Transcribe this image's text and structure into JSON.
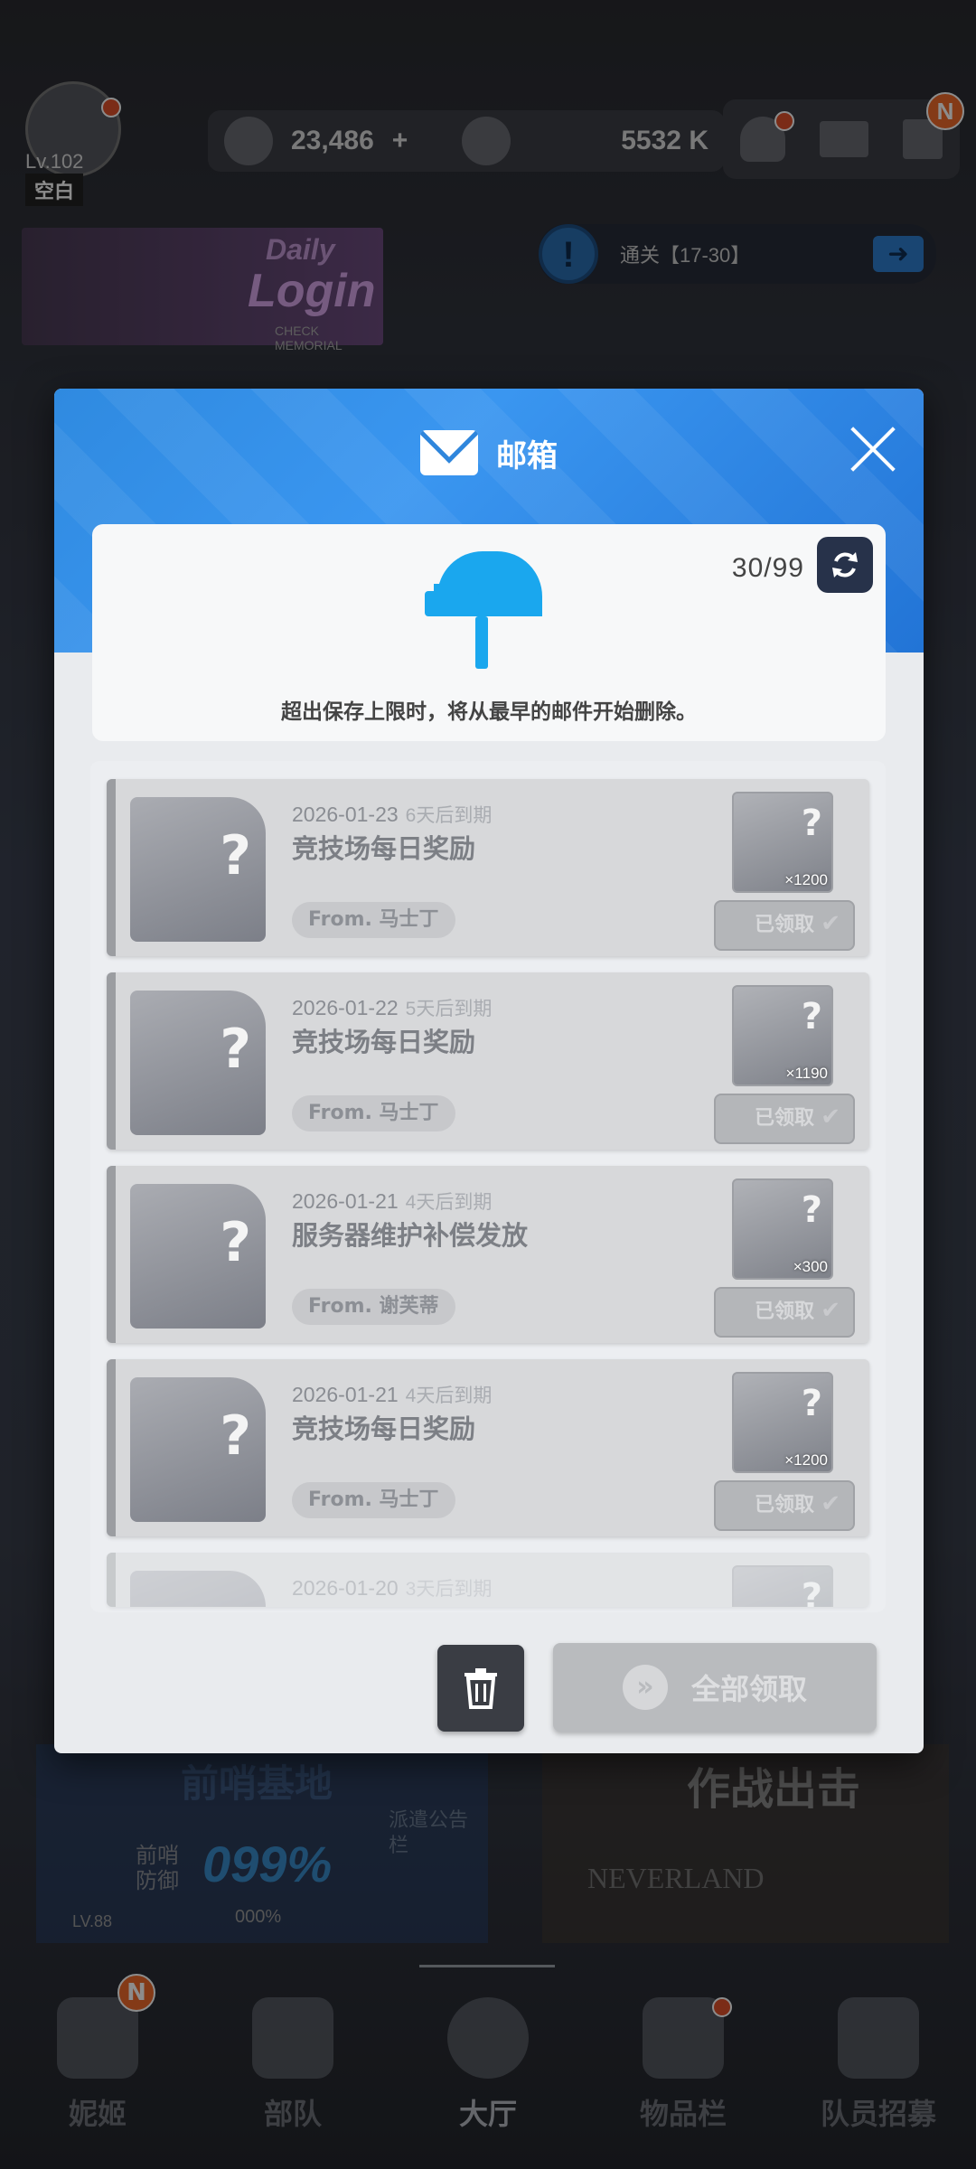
{
  "hud": {
    "player_level": "Lv.102",
    "player_name": "空白",
    "currency_1": "23,486",
    "currency_1_plus": "+",
    "currency_2": "5532 K",
    "mission_text": "通关【17-30】",
    "banner_text_1": "Daily",
    "banner_text_2": "Login",
    "banner_sub": "CHECK MEMORIAL",
    "notification_badge": "N"
  },
  "modal": {
    "title": "邮箱",
    "count": "30/99",
    "info_text": "超出保存上限时，将从最早的邮件开始删除。",
    "claim_all_label": "全部领取",
    "mails": [
      {
        "date": "2026-01-23",
        "expire": "6天后到期",
        "subject": "竞技场每日奖励",
        "from": "From. 马士丁",
        "qty": "×1200",
        "status": "已领取"
      },
      {
        "date": "2026-01-22",
        "expire": "5天后到期",
        "subject": "竞技场每日奖励",
        "from": "From. 马士丁",
        "qty": "×1190",
        "status": "已领取"
      },
      {
        "date": "2026-01-21",
        "expire": "4天后到期",
        "subject": "服务器维护补偿发放",
        "from": "From. 谢芙蒂",
        "qty": "×300",
        "status": "已领取"
      },
      {
        "date": "2026-01-21",
        "expire": "4天后到期",
        "subject": "竞技场每日奖励",
        "from": "From. 马士丁",
        "qty": "×1200",
        "status": "已领取"
      },
      {
        "date": "2026-01-20",
        "expire": "3天后到期"
      }
    ]
  },
  "background_panels": {
    "outpost_title": "前哨基地",
    "outpost_defense": "前哨防御",
    "outpost_percent": "099%",
    "outpost_level": "LV.88",
    "outpost_sub_percent": "000%",
    "dispatch": "派遣公告栏",
    "battle_title": "作战出击",
    "neverland": "NEVERLAND"
  },
  "nav": {
    "items": [
      {
        "label": "妮姬"
      },
      {
        "label": "部队"
      },
      {
        "label": "大厅"
      },
      {
        "label": "物品栏"
      },
      {
        "label": "队员招募"
      }
    ]
  },
  "colors": {
    "header_blue": "#2f8ae0",
    "mailbox_blue": "#1aa7ee",
    "badge_orange": "#f06a2a"
  }
}
